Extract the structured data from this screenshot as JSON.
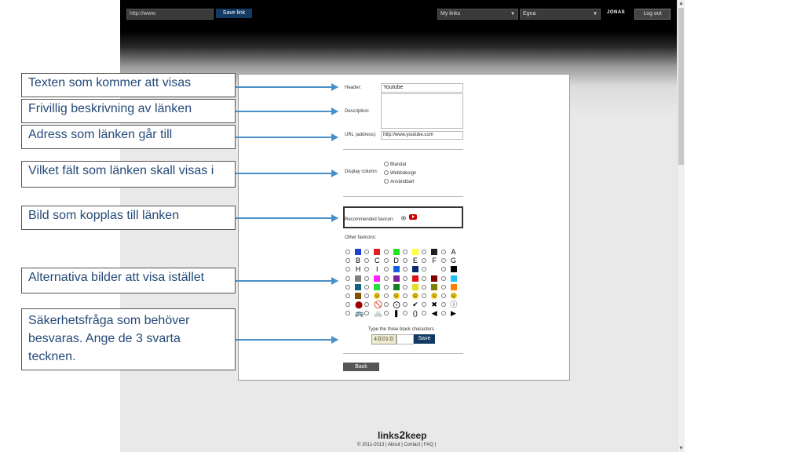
{
  "topbar": {
    "url_input": "http://www.",
    "save_link": "Save link",
    "select1": "My links",
    "select2": "Egna",
    "user": "JONAS",
    "logout": "Log out"
  },
  "form": {
    "header_label": "Header:",
    "header_value": "Youtube",
    "description_label": "Description:",
    "url_label": "URL (address):",
    "url_value": "http://www.youtube.com",
    "display_label": "Display column:",
    "columns": [
      "Blandat",
      "Webbdesign",
      "Användbart"
    ],
    "recommended_label": "Recommended favicon:",
    "other_label": "Other favicons:",
    "captcha_prompt": "Type the three black characters",
    "captcha_text": "4⓪01⓪",
    "save": "Save",
    "back": "Back"
  },
  "colors": {
    "accent": "#123a63",
    "youtube_red": "#cc0000",
    "arrow": "#4a90c8",
    "callout_text": "#244a78"
  },
  "callouts": [
    "Texten som kommer att visas",
    "Frivillig beskrivning av länken",
    "Adress som länken går till",
    "Vilket fält som länken skall visas i",
    "Bild som kopplas till länken",
    "Alternativa bilder att visa istället",
    "Säkerhetsfråga som behöver besvaras. Ange de 3 svarta tecknen."
  ],
  "favicon_grid": [
    [
      "#2040d0",
      "#e02020",
      "#20e020",
      "#ffff40",
      "#202020",
      "A"
    ],
    [
      "B",
      "C",
      "D",
      "E",
      "F",
      "G"
    ],
    [
      "H",
      "I",
      "#1060e0",
      "#0a2a6a",
      "",
      "#000000"
    ],
    [
      "#808080",
      "#ff20ff",
      "#8020a0",
      "#e01010",
      "#800000",
      "#20c0f0"
    ],
    [
      "#106080",
      "#20e040",
      "#108020",
      "#e0e020",
      "#808000",
      "#ff8000"
    ],
    [
      "#805000",
      "☺",
      "☺",
      "☺",
      "☺",
      "☺"
    ],
    [
      "⬤",
      "🚫",
      "⨀",
      "✔",
      "✖",
      "ⓘ"
    ],
    [
      "🚌",
      "🚲",
      "❚",
      "()",
      "◀",
      "▶"
    ]
  ],
  "footer": {
    "logo_prefix": "links",
    "logo_number": "2",
    "logo_suffix": "keep",
    "links": "© 2011-2013 | About | Contact | FAQ |"
  }
}
